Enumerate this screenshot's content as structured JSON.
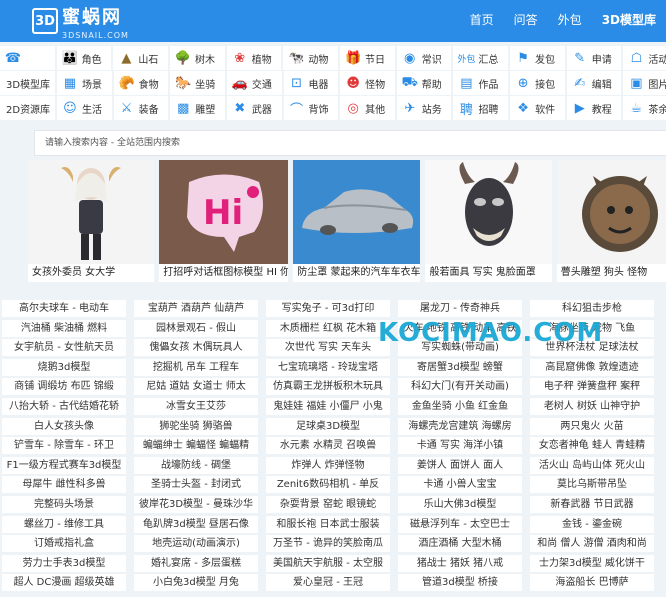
{
  "logo": {
    "mark": "3D",
    "cn": "蜜蜗网",
    "en": "3DSNAIL.COM"
  },
  "nav": [
    {
      "label": "首页"
    },
    {
      "label": "问答"
    },
    {
      "label": "外包"
    },
    {
      "label": "3D模型库",
      "active": true
    }
  ],
  "categories": [
    [
      {
        "label": "",
        "icon": "☎",
        "color": "#2a8ce6",
        "name": "phone-icon"
      },
      {
        "label": "角色",
        "icon": "👪",
        "color": "#3a6fb0",
        "name": "family-icon"
      },
      {
        "label": "山石",
        "icon": "▲",
        "color": "#8c6a2b",
        "name": "mountain-icon"
      },
      {
        "label": "树木",
        "icon": "🌳",
        "color": "#3c8a3a",
        "name": "tree-icon"
      },
      {
        "label": "植物",
        "icon": "❀",
        "color": "#e03a3a",
        "name": "flower-icon"
      },
      {
        "label": "动物",
        "icon": "🐄",
        "color": "#2a8ce6",
        "name": "cow-icon"
      },
      {
        "label": "节日",
        "icon": "🎁",
        "color": "#e03a3a",
        "name": "gift-icon"
      },
      {
        "label": "常识",
        "icon": "◉",
        "color": "#2a8ce6",
        "name": "info-icon"
      },
      {
        "label": "汇总",
        "icon": "外包",
        "color": "#2a8ce6",
        "name": "outsource-icon"
      },
      {
        "label": "发包",
        "icon": "⚑",
        "color": "#2a8ce6",
        "name": "post-task-icon"
      },
      {
        "label": "申请",
        "icon": "✎",
        "color": "#2a8ce6",
        "name": "apply-icon"
      },
      {
        "label": "活动",
        "icon": "☖",
        "color": "#2a8ce6",
        "name": "activity-icon"
      }
    ],
    [
      {
        "label": "3D模型库",
        "icon": "",
        "color": "",
        "name": "model-lib",
        "side": true
      },
      {
        "label": "场景",
        "icon": "▦",
        "color": "#2a8ce6",
        "name": "scene-icon"
      },
      {
        "label": "食物",
        "icon": "🥐",
        "color": "#e08a2a",
        "name": "food-icon"
      },
      {
        "label": "坐骑",
        "icon": "🐎",
        "color": "#3a3a3a",
        "name": "horse-icon"
      },
      {
        "label": "交通",
        "icon": "🚗",
        "color": "#2a8ce6",
        "name": "car-icon"
      },
      {
        "label": "电器",
        "icon": "⊡",
        "color": "#2a8ce6",
        "name": "appliance-icon"
      },
      {
        "label": "怪物",
        "icon": "☻",
        "color": "#e03a3a",
        "name": "monster-icon"
      },
      {
        "label": "帮助",
        "icon": "⛟",
        "color": "#2a8ce6",
        "name": "help-icon"
      },
      {
        "label": "作品",
        "icon": "▤",
        "color": "#2a8ce6",
        "name": "works-icon"
      },
      {
        "label": "接包",
        "icon": "⊕",
        "color": "#2a8ce6",
        "name": "receive-icon"
      },
      {
        "label": "编辑",
        "icon": "✍",
        "color": "#2a8ce6",
        "name": "edit-icon"
      },
      {
        "label": "图片",
        "icon": "▣",
        "color": "#2a8ce6",
        "name": "picture-icon"
      }
    ],
    [
      {
        "label": "2D资源库",
        "icon": "",
        "color": "",
        "name": "2d-lib",
        "side": true
      },
      {
        "label": "生活",
        "icon": "☺",
        "color": "#2a8ce6",
        "name": "life-icon"
      },
      {
        "label": "装备",
        "icon": "⚔",
        "color": "#2a8ce6",
        "name": "equip-icon"
      },
      {
        "label": "雕塑",
        "icon": "▩",
        "color": "#2a8ce6",
        "name": "sculpture-icon"
      },
      {
        "label": "武器",
        "icon": "✖",
        "color": "#2a8ce6",
        "name": "weapon-icon"
      },
      {
        "label": "背饰",
        "icon": "⌒",
        "color": "#2a8ce6",
        "name": "back-deco-icon"
      },
      {
        "label": "其他",
        "icon": "◎",
        "color": "#e03a3a",
        "name": "other-icon"
      },
      {
        "label": "站务",
        "icon": "✈",
        "color": "#2a8ce6",
        "name": "site-icon"
      },
      {
        "label": "招聘",
        "icon": "聘",
        "color": "#2a8ce6",
        "name": "recruit-icon"
      },
      {
        "label": "软件",
        "icon": "❖",
        "color": "#2a8ce6",
        "name": "software-icon"
      },
      {
        "label": "教程",
        "icon": "▶",
        "color": "#2a8ce6",
        "name": "tutorial-icon"
      },
      {
        "label": "茶余",
        "icon": "☕",
        "color": "#2a8ce6",
        "name": "tea-icon"
      }
    ]
  ],
  "search": {
    "placeholder": "请输入搜索内容 - 全站范围内搜索"
  },
  "thumbs": [
    {
      "caption": "女孩外委员 女大学",
      "bg": "#f4f4f4",
      "name": "girl-figure-icon"
    },
    {
      "caption": "打招呼对话框图标模型 HI 你",
      "bg": "#7a5a4a",
      "name": "hi-bubble-icon"
    },
    {
      "caption": "防尘罩 蒙起来的汽车车衣车",
      "bg": "#3a8ad0",
      "name": "covered-car-icon"
    },
    {
      "caption": "般若面具 写实 鬼脸面罩",
      "bg": "#f8f8f8",
      "name": "hannya-mask-icon"
    },
    {
      "caption": "瞢头雕塑 狗头 怪物",
      "bg": "#f4f4f4",
      "name": "dog-head-sculpture-icon"
    }
  ],
  "watermark": "KOCIMAO.COM",
  "tags": [
    [
      "高尔夫球车 - 电动车",
      "宝葫芦 酒葫芦 仙葫芦",
      "写实兔子 - 可3d打印",
      "屠龙刀 - 传奇神兵",
      "科幻狙击步枪"
    ],
    [
      "汽油桶 柴油桶 燃料",
      "园林景观石 - 假山",
      "木质栅栏 红枫 花木箱",
      "火车 地铁 高铁 动车 高铁",
      "海豚坐骑 宠物 飞鱼"
    ],
    [
      "女宇航员 - 女性航天员",
      "傀儡女孩 木偶玩具人",
      "次世代 写实 天车头",
      "写实蜘蛛(带动画)",
      "世界杯法杖 足球法杖"
    ],
    [
      "烧鹅3d模型",
      "挖掘机 吊车 工程车",
      "七宝琉璃塔 - 玲珑宝塔",
      "寄居蟹3d模型 螃蟹",
      "高昆窟佛像 敦煌遗迹"
    ],
    [
      "商铺 调缎坊 布匹 锦缎",
      "尼姑 道姑 女道士 师太",
      "仿真霸王龙拼板积木玩具",
      "科幻大门(有开关动画)",
      "电子秤 弹簧盘秤 案秤"
    ],
    [
      "八抬大轿 - 古代结婚花轿",
      "冰雪女王艾莎",
      "鬼娃娃 福娃 小僵尸 小鬼",
      "金鱼坐骑 小鱼 红金鱼",
      "老树人 树妖 山神守护"
    ],
    [
      "白人女孩头像",
      "狮驼坐骑 狮骆兽",
      "足球桌3D模型",
      "海螺壳龙宫建筑 海螺房",
      "两只鬼火 火苗"
    ],
    [
      "铲雪车 - 除雪车 - 环卫",
      "蝙蝠绅士 蝙蝠怪 蝙蝠精",
      "水元素 水精灵 召唤兽",
      "卡通 写实 海洋小镇",
      "女恋者神龟 蛙人 青蛙精"
    ],
    [
      "F1一级方程式赛车3d模型",
      "战壕防线 - 碉堡",
      "炸弹人 炸弹怪物",
      "姜饼人 面饼人 面人",
      "活火山 岛屿山体 死火山"
    ],
    [
      "母犀牛 雌性科多兽",
      "圣骑士头盔 - 封闭式",
      "Zenit6数码相机 - 单反",
      "卡通 小兽人宝宝",
      "莫比乌斯带吊坠"
    ],
    [
      "完整码头场景",
      "彼岸花3D模型 - 曼珠沙华",
      "杂耍背景 窑蛇 眼镜蛇",
      "乐山大佛3d模型",
      "新春武器 节日武器"
    ],
    [
      "螺丝刀 - 维修工具",
      "龟趴牌3d模型 昼居石像",
      "和服长袍 日本武士服装",
      "磁悬浮列车 - 太空巴士",
      "金钱 - 鎏金碗"
    ],
    [
      "订婚戒指礼盒",
      "地壳运动(动画演示)",
      "万圣节 - 诡异的笑脸南瓜",
      "酒庄酒桶 大型木桶",
      "和尚 僧人 游僧 酒肉和尚"
    ],
    [
      "劳力士手表3d模型",
      "婚礼宴席 - 多层蛋糕",
      "美国航天宇航服 - 太空服",
      "猪战士 猪妖 猪八戒",
      "士力架3d模型 威化饼干"
    ],
    [
      "超人 DC漫画 超级英雄",
      "小白兔3d模型 月兔",
      "爱心皇冠 - 王冠",
      "管道3d模型 桥接",
      "海盗船长 巴博萨"
    ]
  ]
}
